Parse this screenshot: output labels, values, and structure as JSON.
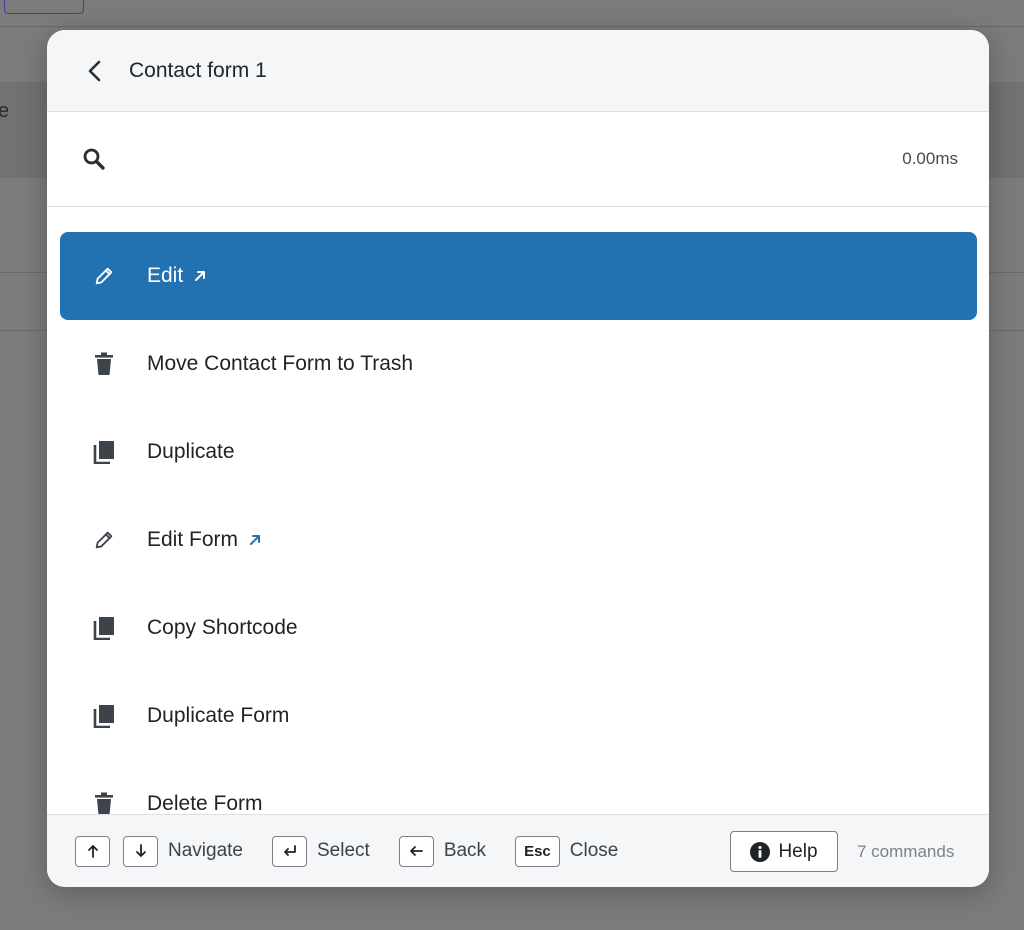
{
  "header": {
    "title": "Contact form 1"
  },
  "search": {
    "placeholder": "",
    "value": "",
    "timing": "0.00ms"
  },
  "commands": [
    {
      "label": "Edit",
      "icon": "pencil-icon",
      "external": true,
      "active": true
    },
    {
      "label": "Move Contact Form to Trash",
      "icon": "trash-icon",
      "external": false,
      "active": false
    },
    {
      "label": "Duplicate",
      "icon": "copy-icon",
      "external": false,
      "active": false
    },
    {
      "label": "Edit Form",
      "icon": "pencil-icon",
      "external": true,
      "active": false
    },
    {
      "label": "Copy Shortcode",
      "icon": "copy-icon",
      "external": false,
      "active": false
    },
    {
      "label": "Duplicate Form",
      "icon": "copy-icon",
      "external": false,
      "active": false
    },
    {
      "label": "Delete Form",
      "icon": "trash-icon",
      "external": false,
      "active": false
    }
  ],
  "footer": {
    "navigate_label": "Navigate",
    "select_label": "Select",
    "back_label": "Back",
    "close_key": "Esc",
    "close_label": "Close",
    "help_label": "Help",
    "count_label": "7 commands"
  },
  "colors": {
    "accent": "#2271b1",
    "backdrop": "#7c7c7c",
    "header_bg": "#f4f6f7"
  }
}
